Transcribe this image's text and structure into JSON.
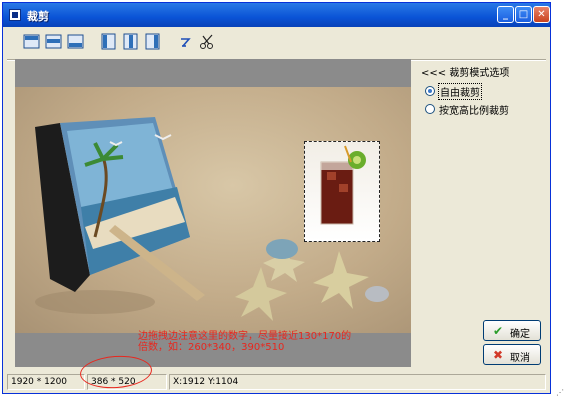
{
  "window": {
    "title": "裁剪"
  },
  "title_buttons": {
    "minimize": "_",
    "maximize": "□",
    "close": "✕"
  },
  "toolbar": {
    "tools": [
      {
        "icon": "align-top-bar-icon"
      },
      {
        "icon": "align-middle-bar-icon"
      },
      {
        "icon": "align-bottom-bar-icon"
      },
      {
        "icon": "align-left-bar-icon"
      },
      {
        "icon": "align-center-bar-icon"
      },
      {
        "icon": "align-right-bar-icon"
      },
      {
        "icon": "rotate-arrow-icon"
      },
      {
        "icon": "scissors-icon"
      }
    ]
  },
  "panel": {
    "title": "<<< 裁剪模式选项",
    "options": [
      {
        "label": "自由裁剪",
        "selected": true
      },
      {
        "label": "按宽高比例裁剪",
        "selected": false
      }
    ]
  },
  "buttons": {
    "ok": {
      "icon": "check-icon",
      "label": "确定"
    },
    "cancel": {
      "icon": "cross-icon",
      "label": "取消"
    }
  },
  "annotation": {
    "text": "边拖拽边注意这里的数字，尽量接近130*170的倍数，如：260*340，390*510"
  },
  "status": {
    "image_size": "1920 * 1200",
    "selection_size": "386 * 520",
    "coords": "X:1912 Y:1104"
  },
  "colors": {
    "titlebar": "#0a53d6",
    "annotation": "#e8271e",
    "ok_icon": "#2a9d2a",
    "cancel_icon": "#d23a2a"
  }
}
